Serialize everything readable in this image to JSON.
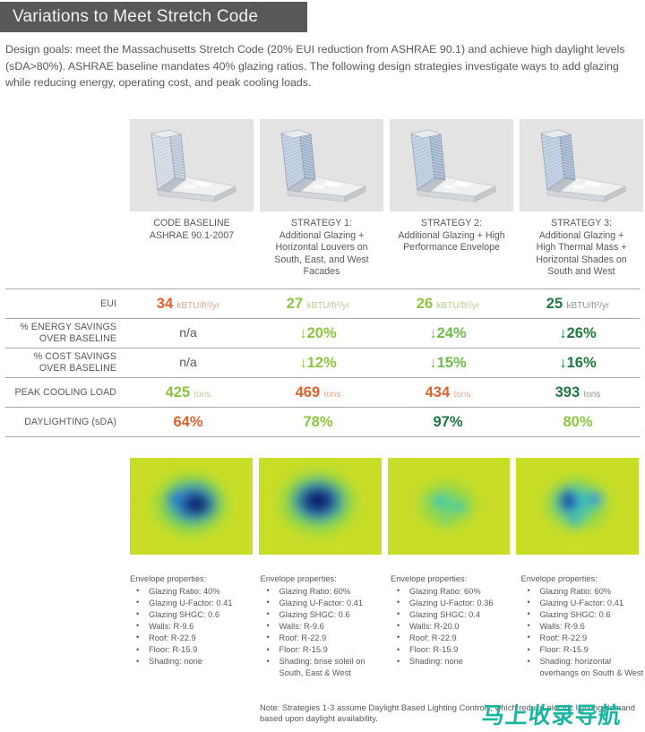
{
  "header": {
    "title": "Variations to Meet Stretch Code",
    "bar_color": "#58585a"
  },
  "intro": {
    "text": "Design goals: meet the Massachusetts Stretch Code (20% EUI reduction from ASHRAE 90.1) and achieve high daylight levels (sDA>80%). ASHRAE baseline mandates 40% glazing ratios. The following design strategies investigate ways to add glazing while reducing energy, operating cost, and peak cooling loads."
  },
  "colors": {
    "orange": "#e0622a",
    "light_green": "#8cc63f",
    "mid_green": "#6cbe45",
    "dark_green": "#1d7a3e",
    "unit_gray": "#a9a9a9",
    "unit_green": "#a8c98a",
    "text_gray": "#58585a"
  },
  "columns": [
    {
      "caption": "CODE BASELINE\nASHRAE 90.1-2007",
      "render_name": "render-code-baseline",
      "map_name": "daylight-map-code-baseline"
    },
    {
      "caption": "STRATEGY 1:\nAdditional Glazing +\nHorizontal Louvers on\nSouth, East, and West\nFacades",
      "render_name": "render-strategy-1",
      "map_name": "daylight-map-strategy-1"
    },
    {
      "caption": "STRATEGY 2:\nAdditional Glazing + High\nPerformance Envelope",
      "render_name": "render-strategy-2",
      "map_name": "daylight-map-strategy-2"
    },
    {
      "caption": "STRATEGY 3:\nAdditional Glazing +\nHigh Thermal Mass +\nHorizontal Shades on\nSouth and West",
      "render_name": "render-strategy-3",
      "map_name": "daylight-map-strategy-3"
    }
  ],
  "table": {
    "rows": [
      {
        "label": "EUI",
        "cells": [
          {
            "value": "34",
            "unit": "kBTU/ft²/yr",
            "color": "#e0622a",
            "unit_color": "#d8a991"
          },
          {
            "value": "27",
            "unit": "kBTU/ft²/yr",
            "color": "#8cc63f",
            "unit_color": "#b4cf8e"
          },
          {
            "value": "26",
            "unit": "kBTU/ft²/yr",
            "color": "#8cc63f",
            "unit_color": "#b4cf8e"
          },
          {
            "value": "25",
            "unit": "kBTU/ft²/yr",
            "color": "#1d7a3e",
            "unit_color": "#8a9c85"
          }
        ]
      },
      {
        "label": "% ENERGY SAVINGS\nOVER BASELINE",
        "cells": [
          {
            "value": "n/a",
            "unit": "",
            "color": "#58585a",
            "unit_color": "#58585a"
          },
          {
            "value": "↓20%",
            "unit": "",
            "color": "#8cc63f",
            "unit_color": "#8cc63f"
          },
          {
            "value": "↓24%",
            "unit": "",
            "color": "#6cbe45",
            "unit_color": "#6cbe45"
          },
          {
            "value": "↓26%",
            "unit": "",
            "color": "#1d7a3e",
            "unit_color": "#1d7a3e"
          }
        ]
      },
      {
        "label": "% COST SAVINGS\nOVER BASELINE",
        "cells": [
          {
            "value": "n/a",
            "unit": "",
            "color": "#58585a",
            "unit_color": "#58585a"
          },
          {
            "value": "↓12%",
            "unit": "",
            "color": "#8cc63f",
            "unit_color": "#8cc63f"
          },
          {
            "value": "↓15%",
            "unit": "",
            "color": "#6cbe45",
            "unit_color": "#6cbe45"
          },
          {
            "value": "↓16%",
            "unit": "",
            "color": "#1d7a3e",
            "unit_color": "#1d7a3e"
          }
        ]
      },
      {
        "label": "PEAK COOLING LOAD",
        "cells": [
          {
            "value": "425",
            "unit": "tons",
            "color": "#8cc63f",
            "unit_color": "#b4cf8e"
          },
          {
            "value": "469",
            "unit": "tons",
            "color": "#e0622a",
            "unit_color": "#d8a991"
          },
          {
            "value": "434",
            "unit": "tons",
            "color": "#e0622a",
            "unit_color": "#d8a991"
          },
          {
            "value": "393",
            "unit": "tons",
            "color": "#1d7a3e",
            "unit_color": "#8a9c85"
          }
        ]
      },
      {
        "label": "DAYLIGHTING (sDA)",
        "cells": [
          {
            "value": "64%",
            "unit": "",
            "color": "#e0622a",
            "unit_color": "#e0622a"
          },
          {
            "value": "78%",
            "unit": "",
            "color": "#8cc63f",
            "unit_color": "#8cc63f"
          },
          {
            "value": "97%",
            "unit": "",
            "color": "#1d7a3e",
            "unit_color": "#1d7a3e"
          },
          {
            "value": "80%",
            "unit": "",
            "color": "#8cc63f",
            "unit_color": "#8cc63f"
          }
        ]
      }
    ]
  },
  "envelopes": [
    {
      "title": "Envelope properties:",
      "items": [
        "Glazing Ratio: 40%",
        "Glazing U-Factor: 0.41",
        "Glazing SHGC: 0.6",
        "Walls: R-9.6",
        "Roof: R-22.9",
        "Floor: R-15.9",
        "Shading: none"
      ]
    },
    {
      "title": "Envelope properties:",
      "items": [
        "Glazing Ratio: 60%",
        "Glazing U-Factor: 0.41",
        "Glazing SHGC: 0.6",
        "Walls: R-9.6",
        "Roof: R-22.9",
        "Floor: R-15.9",
        "Shading: brise soleil on South, East & West"
      ]
    },
    {
      "title": "Envelope properties:",
      "items": [
        "Glazing Ratio: 60%",
        "Glazing U-Factor: 0.36",
        "Glazing SHGC: 0.4",
        "Walls: R-20.0",
        "Roof: R-22.9",
        "Floor: R-15.9",
        "Shading: none"
      ]
    },
    {
      "title": "Envelope properties:",
      "items": [
        "Glazing Ratio: 60%",
        "Glazing U-Factor: 0.41",
        "Glazing SHGC: 0.6",
        "Walls: R-9.6",
        "Roof: R-22.9",
        "Floor: R-15.9",
        "Shading: horizontal overhangs on South & West"
      ]
    }
  ],
  "footnote": {
    "text": "Note: Strategies 1-3 assume Daylight Based Lighting Controls, which reduce electric lighting demand based upon daylight availability."
  },
  "watermark": {
    "text": "马上收录导航",
    "color": "#19b5a0"
  }
}
